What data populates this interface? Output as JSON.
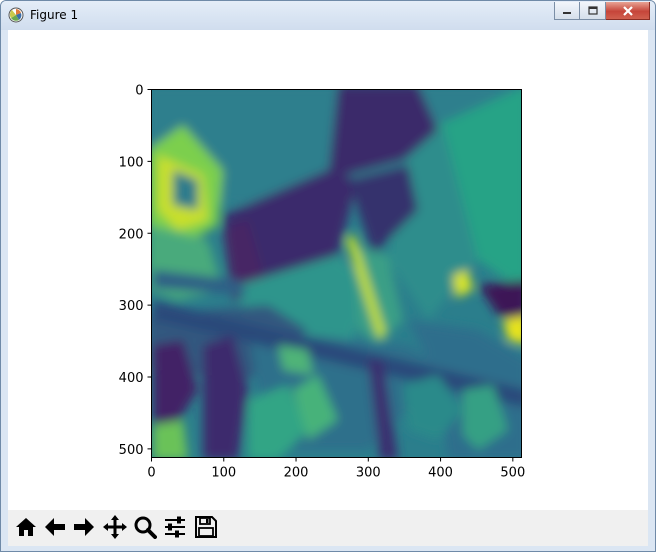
{
  "window": {
    "title": "Figure 1",
    "icons": [
      "matplotlib-app-icon",
      "minimize-icon",
      "maximize-icon",
      "close-icon"
    ]
  },
  "chart_data": {
    "type": "heatmap",
    "title": "",
    "xlabel": "",
    "ylabel": "",
    "xlim": [
      0,
      512
    ],
    "ylim": [
      512,
      0
    ],
    "x_ticks": [
      "0",
      "100",
      "200",
      "300",
      "400",
      "500"
    ],
    "y_ticks": [
      "0",
      "100",
      "200",
      "300",
      "400",
      "500"
    ],
    "colormap": "viridis",
    "grid": false,
    "legend": "none"
  },
  "toolbar": {
    "buttons": [
      {
        "name": "home",
        "icon": "home-icon"
      },
      {
        "name": "back",
        "icon": "arrow-left-icon"
      },
      {
        "name": "forward",
        "icon": "arrow-right-icon"
      },
      {
        "name": "pan",
        "icon": "move-icon"
      },
      {
        "name": "zoom",
        "icon": "magnifier-icon"
      },
      {
        "name": "configure-subplots",
        "icon": "sliders-icon"
      },
      {
        "name": "save",
        "icon": "floppy-icon"
      }
    ]
  },
  "colors": {
    "viridis_dark": "#440154",
    "viridis_purple": "#3b2b6e",
    "viridis_blue": "#31688e",
    "viridis_teal": "#2a8a8a",
    "viridis_green": "#35b779",
    "viridis_yellow": "#fde725",
    "toolbar_bg": "#f0f0f0"
  }
}
